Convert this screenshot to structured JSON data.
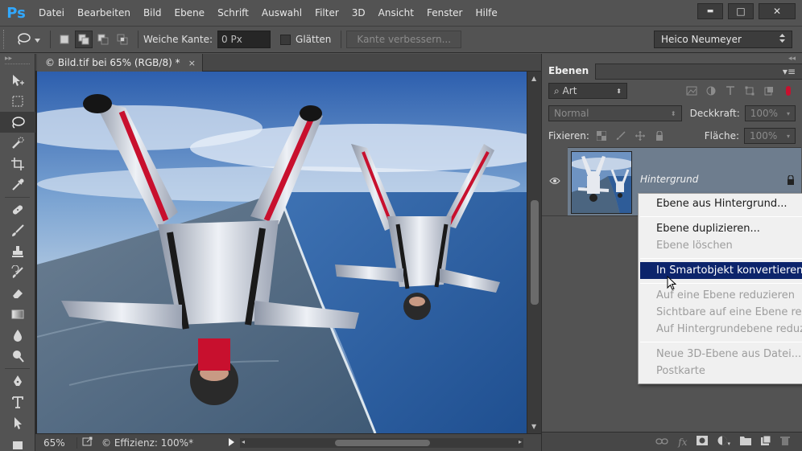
{
  "app": {
    "logo": "Ps"
  },
  "menubar": {
    "items": [
      "Datei",
      "Bearbeiten",
      "Bild",
      "Ebene",
      "Schrift",
      "Auswahl",
      "Filter",
      "3D",
      "Ansicht",
      "Fenster",
      "Hilfe"
    ],
    "window_controls": {
      "minimize": "▬",
      "maximize": "□",
      "close": "✕"
    }
  },
  "options_bar": {
    "tool_icon": "lasso-icon",
    "feather_label": "Weiche Kante:",
    "feather_value": "0 Px",
    "antialias_label": "Glätten",
    "refine_edge_label": "Kante verbessern...",
    "workspace_user": "Heico Neumeyer"
  },
  "toolbar": {
    "collapse": "▸▸",
    "tools": [
      "move-tool",
      "marquee-tool",
      "lasso-tool",
      "quick-selection-tool",
      "crop-tool",
      "eyedropper-tool",
      "healing-tool",
      "brush-tool",
      "stamp-tool",
      "history-brush-tool",
      "eraser-tool",
      "gradient-tool",
      "blur-tool",
      "dodge-tool",
      "pen-tool",
      "type-tool",
      "path-selection-tool",
      "shape-tool"
    ]
  },
  "document": {
    "tab_title": "© Bild.tif bei 65% (RGB/8) *",
    "tab_close": "×",
    "zoom": "65%",
    "efficiency": "© Effizienz: 100%*"
  },
  "layers_panel": {
    "collapse": "◂◂",
    "tab_label": "Ebenen",
    "menu_icon": "▾≡",
    "filter_label": "Art",
    "blend_mode": "Normal",
    "opacity_label": "Deckkraft:",
    "opacity_value": "100%",
    "lock_label": "Fixieren:",
    "fill_label": "Fläche:",
    "fill_value": "100%",
    "layer_name": "Hintergrund"
  },
  "context_menu": {
    "groups": [
      [
        {
          "label": "Ebene aus Hintergrund...",
          "enabled": true
        }
      ],
      [
        {
          "label": "Ebene duplizieren...",
          "enabled": true
        },
        {
          "label": "Ebene löschen",
          "enabled": false
        }
      ],
      [
        {
          "label": "In Smartobjekt konvertieren",
          "enabled": true,
          "highlighted": true
        }
      ],
      [
        {
          "label": "Auf eine Ebene reduzieren",
          "enabled": false
        },
        {
          "label": "Sichtbare auf eine Ebene reduzieren",
          "enabled": false
        },
        {
          "label": "Auf Hintergrundebene reduzieren",
          "enabled": false
        }
      ],
      [
        {
          "label": "Neue 3D-Ebene aus Datei...",
          "enabled": false
        },
        {
          "label": "Postkarte",
          "enabled": false
        }
      ]
    ]
  },
  "colors": {
    "ui_gray": "#535353",
    "layer_selected": "#6e7d8e",
    "menu_highlight": "#0c246b",
    "ps_blue": "#31a8ff"
  }
}
